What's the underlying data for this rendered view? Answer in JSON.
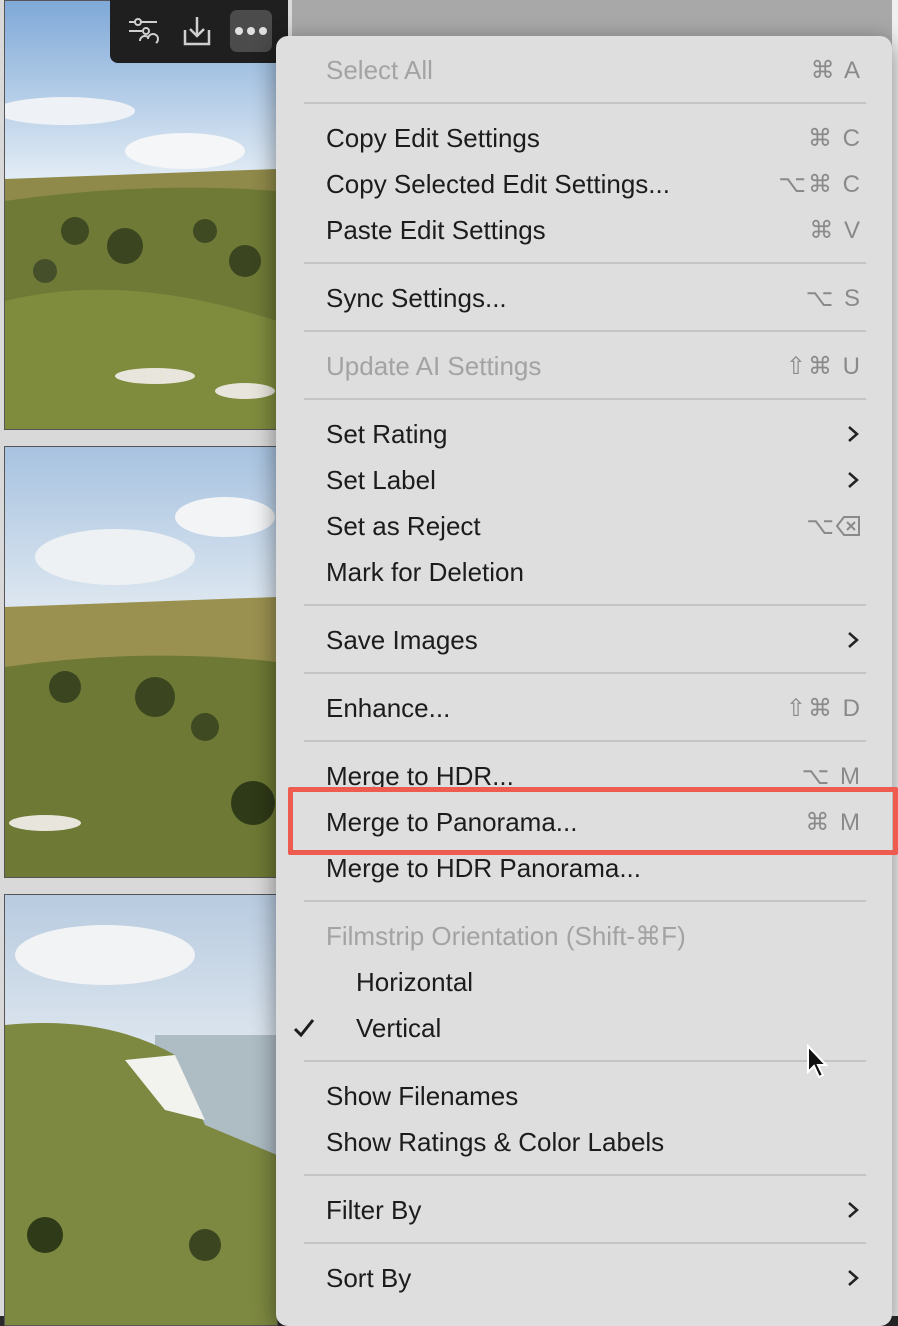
{
  "toolbar": {
    "buttons": [
      "adjust-icon",
      "import-icon",
      "more-icon"
    ]
  },
  "menu": {
    "items": [
      {
        "label": "Select All",
        "shortcut": "⌘ A"
      },
      {
        "label": "Copy Edit Settings",
        "shortcut": "⌘ C"
      },
      {
        "label": "Copy Selected Edit Settings...",
        "shortcut": "⌥⌘ C"
      },
      {
        "label": "Paste Edit Settings",
        "shortcut": "⌘ V"
      },
      {
        "label": "Sync Settings...",
        "shortcut": "⌥ S"
      },
      {
        "label": "Update AI Settings",
        "shortcut": "⇧⌘ U"
      },
      {
        "label": "Set Rating"
      },
      {
        "label": "Set Label"
      },
      {
        "label": "Set as Reject",
        "shortcut": "⌥"
      },
      {
        "label": "Mark for Deletion"
      },
      {
        "label": "Save Images"
      },
      {
        "label": "Enhance...",
        "shortcut": "⇧⌘ D"
      },
      {
        "label": "Merge to HDR...",
        "shortcut": "⌥ M"
      },
      {
        "label": "Merge to Panorama...",
        "shortcut": "⌘ M"
      },
      {
        "label": "Merge to HDR Panorama..."
      },
      {
        "label": "Filmstrip Orientation (Shift-⌘F)"
      },
      {
        "label": "Horizontal"
      },
      {
        "label": "Vertical"
      },
      {
        "label": "Show Filenames"
      },
      {
        "label": "Show Ratings & Color Labels"
      },
      {
        "label": "Filter By"
      },
      {
        "label": "Sort By"
      }
    ]
  },
  "colors": {
    "menu_bg": "#dedede",
    "highlight_border": "#ee5b4f",
    "toolbar_bg": "#1f1f1f"
  }
}
